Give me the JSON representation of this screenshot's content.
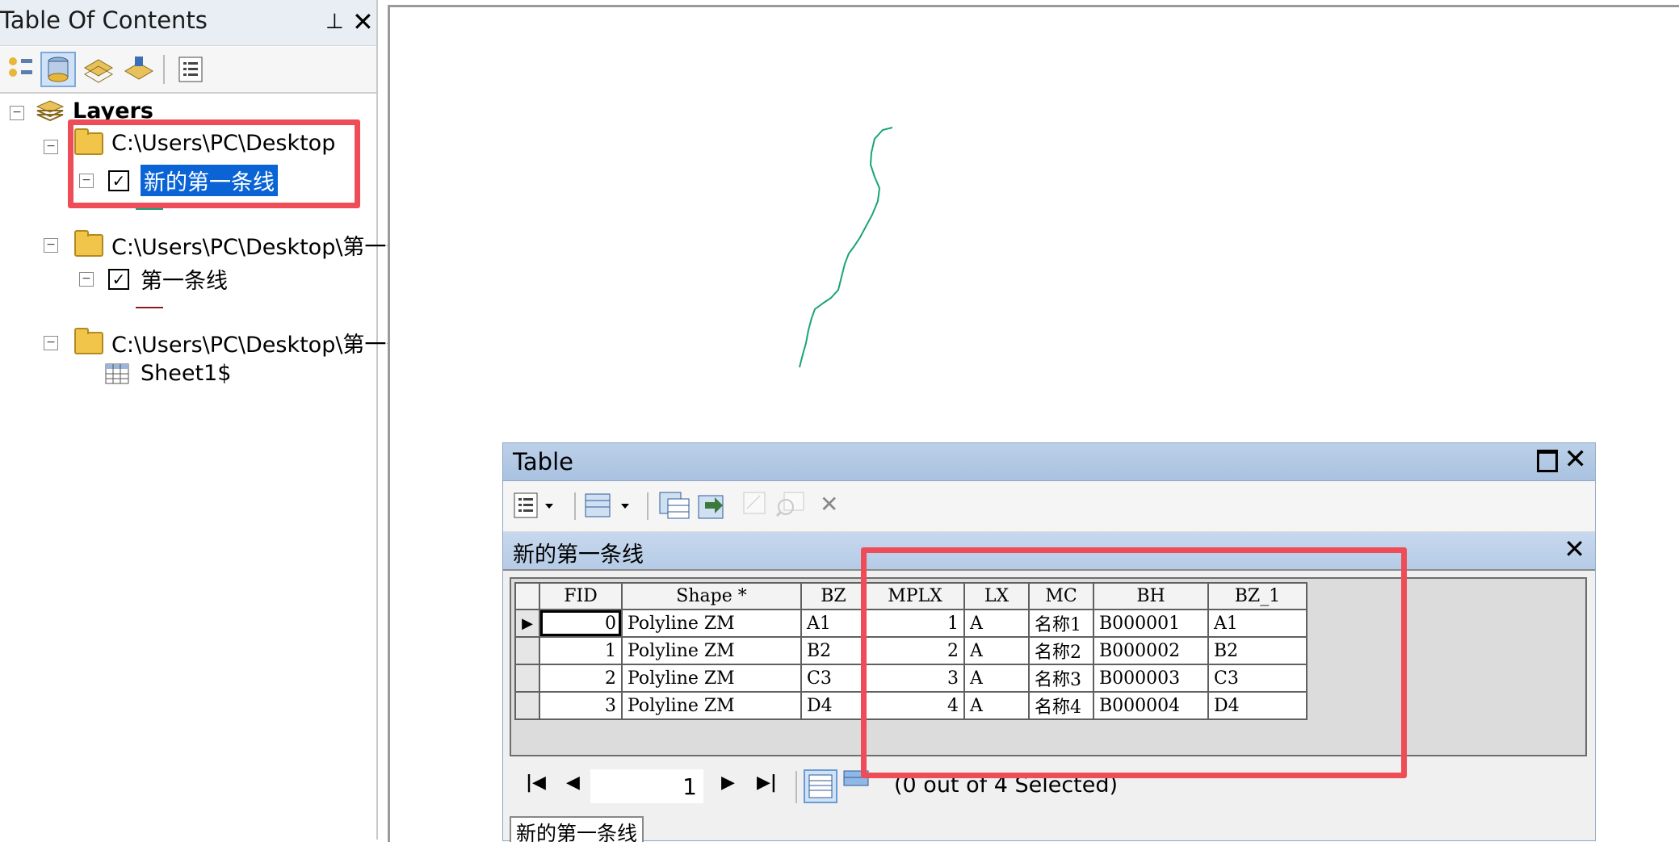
{
  "toc": {
    "title": "Table Of Contents",
    "pin_icon": "pin-icon",
    "close_icon": "close-icon",
    "tree": {
      "root": "Layers",
      "groups": [
        {
          "path": "C:\\Users\\PC\\Desktop",
          "layer": "新的第一条线",
          "checked": true,
          "symbol_color": "#1aa37a"
        },
        {
          "path": "C:\\Users\\PC\\Desktop\\第一条",
          "layer": "第一条线",
          "checked": true,
          "symbol_color": "#8b1a1a"
        },
        {
          "path": "C:\\Users\\PC\\Desktop\\第一条",
          "layer": "Sheet1$"
        }
      ]
    }
  },
  "table_window": {
    "title": "Table",
    "layer_tab_title": "新的第一条线",
    "columns": [
      "FID",
      "Shape *",
      "BZ",
      "MPLX",
      "LX",
      "MC",
      "BH",
      "BZ_1"
    ],
    "rows": [
      [
        "0",
        "Polyline ZM",
        "A1",
        "1",
        "A",
        "名称1",
        "B000001",
        "A1"
      ],
      [
        "1",
        "Polyline ZM",
        "B2",
        "2",
        "A",
        "名称2",
        "B000002",
        "B2"
      ],
      [
        "2",
        "Polyline ZM",
        "C3",
        "3",
        "A",
        "名称3",
        "B000003",
        "C3"
      ],
      [
        "3",
        "Polyline ZM",
        "D4",
        "4",
        "A",
        "名称4",
        "B000004",
        "D4"
      ]
    ],
    "page_number": "1",
    "selection_status": "(0 out of 4 Selected)",
    "bottom_tab": "新的第一条线"
  },
  "colors": {
    "highlight_box": "#ee4d57",
    "map_line": "#1aa37a",
    "selection_blue": "#0a64d6"
  }
}
